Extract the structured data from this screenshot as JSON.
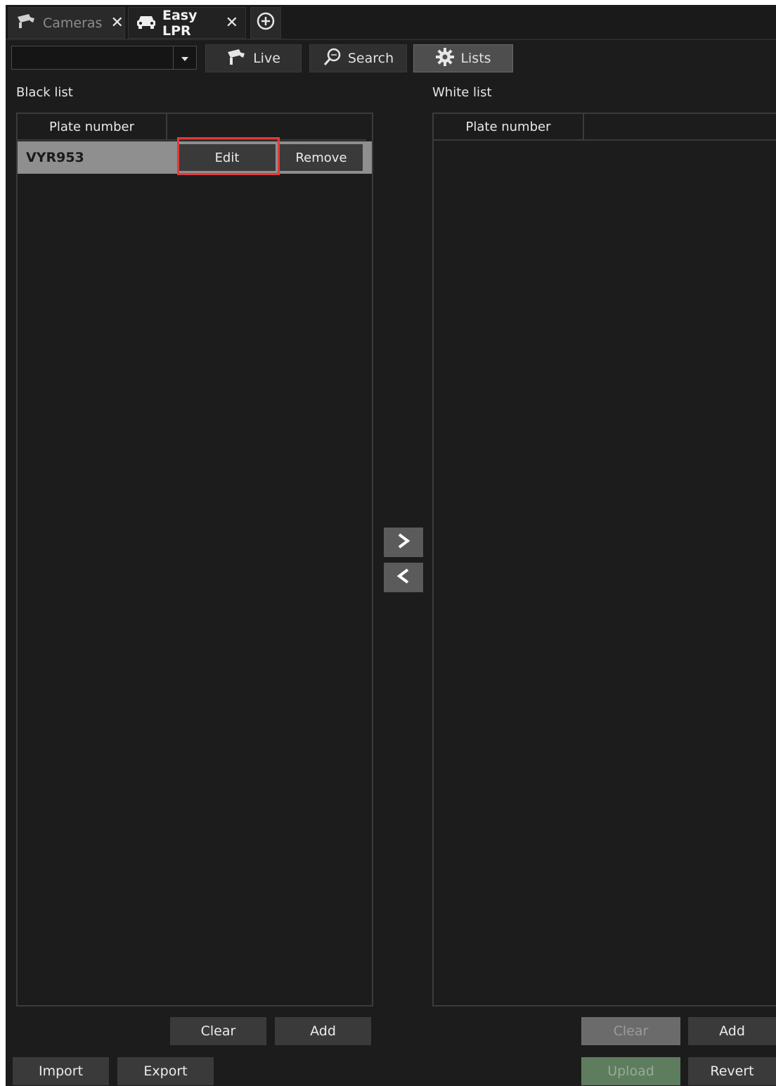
{
  "tabs": [
    {
      "label": "Cameras",
      "icon": "cctv-camera-icon",
      "active": false
    },
    {
      "label": "Easy LPR",
      "icon": "car-icon",
      "active": true
    }
  ],
  "toolbar": {
    "dropdown_value": "",
    "live_label": "Live",
    "search_label": "Search",
    "lists_label": "Lists",
    "selected": "Lists"
  },
  "black_list": {
    "title": "Black list",
    "column_header": "Plate number",
    "rows": [
      {
        "plate": "VYR953",
        "edit_label": "Edit",
        "remove_label": "Remove"
      }
    ],
    "clear_label": "Clear",
    "add_label": "Add",
    "import_label": "Import",
    "export_label": "Export"
  },
  "white_list": {
    "title": "White list",
    "column_header": "Plate number",
    "rows": [],
    "clear_label": "Clear",
    "add_label": "Add",
    "upload_label": "Upload",
    "revert_label": "Revert"
  },
  "transfer": {
    "right_icon": "chevron-right-icon",
    "left_icon": "chevron-left-icon"
  },
  "colors": {
    "background": "#1c1c1c",
    "highlight": "#e23a3a",
    "upload_button": "#5e7d5e"
  }
}
